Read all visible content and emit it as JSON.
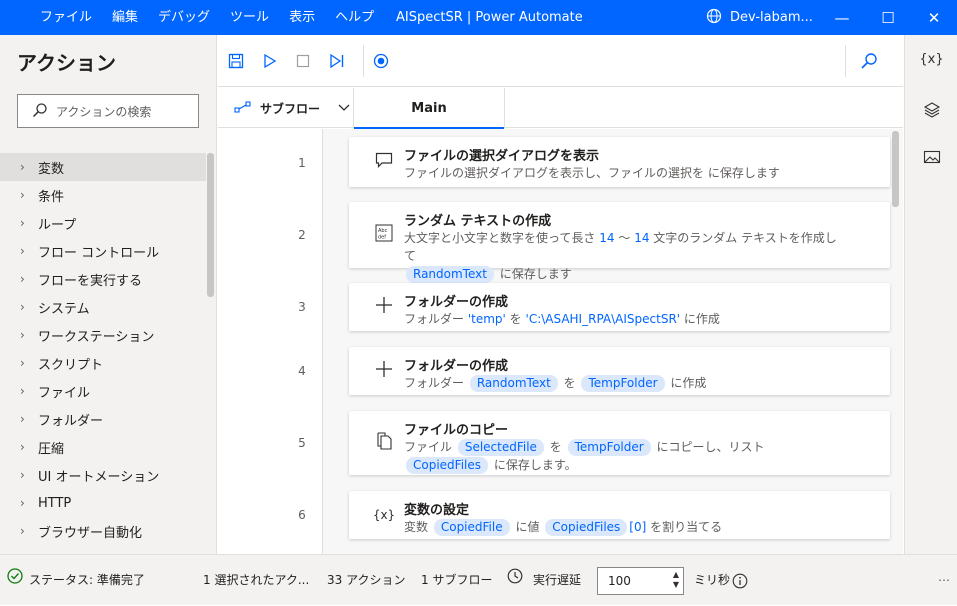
{
  "titlebar": {
    "menu": [
      "ファイル",
      "編集",
      "デバッグ",
      "ツール",
      "表示",
      "ヘルプ"
    ],
    "title": "AISpectSR | Power Automate",
    "environment": "Dev-labam..."
  },
  "actions_pane": {
    "title": "アクション",
    "search_placeholder": "アクションの検索",
    "categories": [
      "変数",
      "条件",
      "ループ",
      "フロー コントロール",
      "フローを実行する",
      "システム",
      "ワークステーション",
      "スクリプト",
      "ファイル",
      "フォルダー",
      "圧縮",
      "UI オートメーション",
      "HTTP",
      "ブラウザー自動化"
    ]
  },
  "tabs": {
    "subflow_label": "サブフロー",
    "main_tab": "Main"
  },
  "steps": [
    {
      "n": "1",
      "title": "ファイルの選択ダイアログを表示",
      "desc": "ファイルの選択ダイアログを表示し、ファイルの選択を  に保存します"
    },
    {
      "n": "2",
      "title": "ランダム テキストの作成",
      "d1": "大文字と小文字と数字を使って長さ",
      "d2": "14",
      "d3": "〜",
      "d4": "14",
      "d5": "文字のランダム テキストを作成して",
      "v1": "RandomText",
      "d6": "に保存します"
    },
    {
      "n": "3",
      "title": "フォルダーの作成",
      "d1": "フォルダー",
      "q1": "'temp'",
      "d2": "を",
      "q2": "'C:\\ASAHI_RPA\\AISpectSR'",
      "d3": "に作成"
    },
    {
      "n": "4",
      "title": "フォルダーの作成",
      "d1": "フォルダー",
      "v1": "RandomText",
      "d2": "を",
      "v2": "TempFolder",
      "d3": "に作成"
    },
    {
      "n": "5",
      "title": "ファイルのコピー",
      "d1": "ファイル",
      "v1": "SelectedFile",
      "d2": "を",
      "v2": "TempFolder",
      "d3": "にコピーし、リスト",
      "v3": "CopiedFiles",
      "d4": "に保存します。"
    },
    {
      "n": "6",
      "title": "変数の設定",
      "d1": "変数",
      "v1": "CopiedFile",
      "d2": "に値",
      "v2": "CopiedFiles",
      "idx": "[0]",
      "d3": "を割り当てる"
    }
  ],
  "statusbar": {
    "status": "ステータス: 準備完了",
    "selected": "1 選択されたアク...",
    "actions": "33 アクション",
    "subflows": "1 サブフロー",
    "delay_label": "実行遅延",
    "delay_value": "100",
    "unit": "ミリ秒"
  },
  "colors": {
    "accent": "#0066ff",
    "variable_bg": "#dbe8fb"
  }
}
